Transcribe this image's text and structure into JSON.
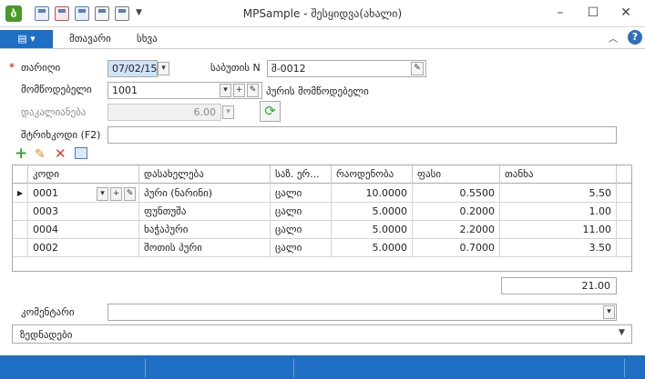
{
  "window": {
    "title": "MPSample - შესყიდვა(ახალი)",
    "app_icon": "green-app-icon"
  },
  "ribbon": {
    "file_icon": "menu-icon",
    "tabs": [
      "მთავარი",
      "სხვა"
    ],
    "help": "?",
    "collapse": "︿"
  },
  "form": {
    "date_label": "თარიღი",
    "date_value": "07/02/15",
    "docno_label": "საბუთის N",
    "docno_value": "შ-0012",
    "supplier_label": "მომწოდებელი",
    "supplier_value": "1001",
    "supplier_name": "პურის მომწოდებელი",
    "discount_label": "დაკალიანება",
    "discount_value": "6.00",
    "barcode_label": "შტრიხკოდი (F2)",
    "barcode_value": "",
    "comment_label": "კომენტარი",
    "extras_label": "ზედნადები"
  },
  "grid": {
    "columns": [
      "კოდი",
      "დასახელება",
      "საზ. ერ...",
      "რაოდენობა",
      "ფასი",
      "თანხა"
    ],
    "rows": [
      {
        "code": "0001",
        "name": "პური (ნარინი)",
        "unit": "ცალი",
        "qty": "10.0000",
        "price": "0.5500",
        "sum": "5.50"
      },
      {
        "code": "0003",
        "name": "ფუნთუშა",
        "unit": "ცალი",
        "qty": "5.0000",
        "price": "0.2000",
        "sum": "1.00"
      },
      {
        "code": "0004",
        "name": "ხაჭაპური",
        "unit": "ცალი",
        "qty": "5.0000",
        "price": "2.2000",
        "sum": "11.00"
      },
      {
        "code": "0002",
        "name": "შოთის პური",
        "unit": "ცალი",
        "qty": "5.0000",
        "price": "0.7000",
        "sum": "3.50"
      }
    ],
    "total": "21.00"
  },
  "colors": {
    "accent": "#1e6fc3",
    "add": "#3aa53a",
    "delete": "#d83b2a"
  }
}
